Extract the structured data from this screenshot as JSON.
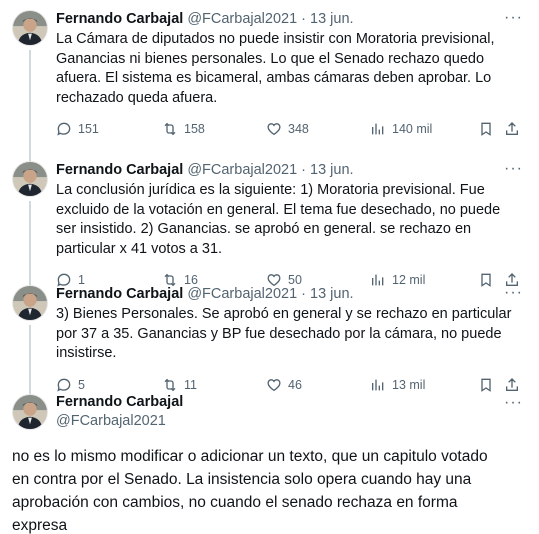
{
  "tweets": [
    {
      "name": "Fernando Carbajal",
      "handle": "@FCarbajal2021",
      "separator": "·",
      "date": "13 jun.",
      "more": "···",
      "text": "La Cámara de diputados no puede insistir con Moratoria previsional, Ganancias ni bienes personales. Lo que el Senado rechazo quedo afuera. El sistema es bicameral, ambas cámaras deben aprobar. Lo rechazado queda afuera.",
      "replies": "151",
      "retweets": "158",
      "likes": "348",
      "views": "140 mil"
    },
    {
      "name": "Fernando Carbajal",
      "handle": "@FCarbajal2021",
      "separator": "·",
      "date": "13 jun.",
      "more": "···",
      "text": "La conclusión jurídica es la siguiente: 1) Moratoria previsional. Fue excluido de la votación en general. El tema fue desechado, no puede ser insistido. 2) Ganancias. se aprobó en general. se rechazo en particular x 41 votos a 31.",
      "replies": "1",
      "retweets": "16",
      "likes": "50",
      "views": "12 mil"
    },
    {
      "name": "Fernando Carbajal",
      "handle": "@FCarbajal2021",
      "separator": "·",
      "date": "13 jun.",
      "more": "···",
      "text": "3) Bienes Personales. Se aprobó en general y se rechazo en particular por 37 a 35. Ganancias y BP fue desechado por la cámara, no puede insistirse.",
      "replies": "5",
      "retweets": "11",
      "likes": "46",
      "views": "13 mil"
    }
  ],
  "main": {
    "name": "Fernando Carbajal",
    "handle": "@FCarbajal2021",
    "more": "···",
    "text": "no es lo mismo modificar o adicionar un texto, que un capitulo votado en contra por el Senado. La insistencia solo opera cuando hay una aprobación con cambios, no cuando el senado rechaza en forma expresa"
  },
  "colors": {
    "text": "#0f1419",
    "muted": "#536471",
    "thread_line": "#cfd9de"
  }
}
